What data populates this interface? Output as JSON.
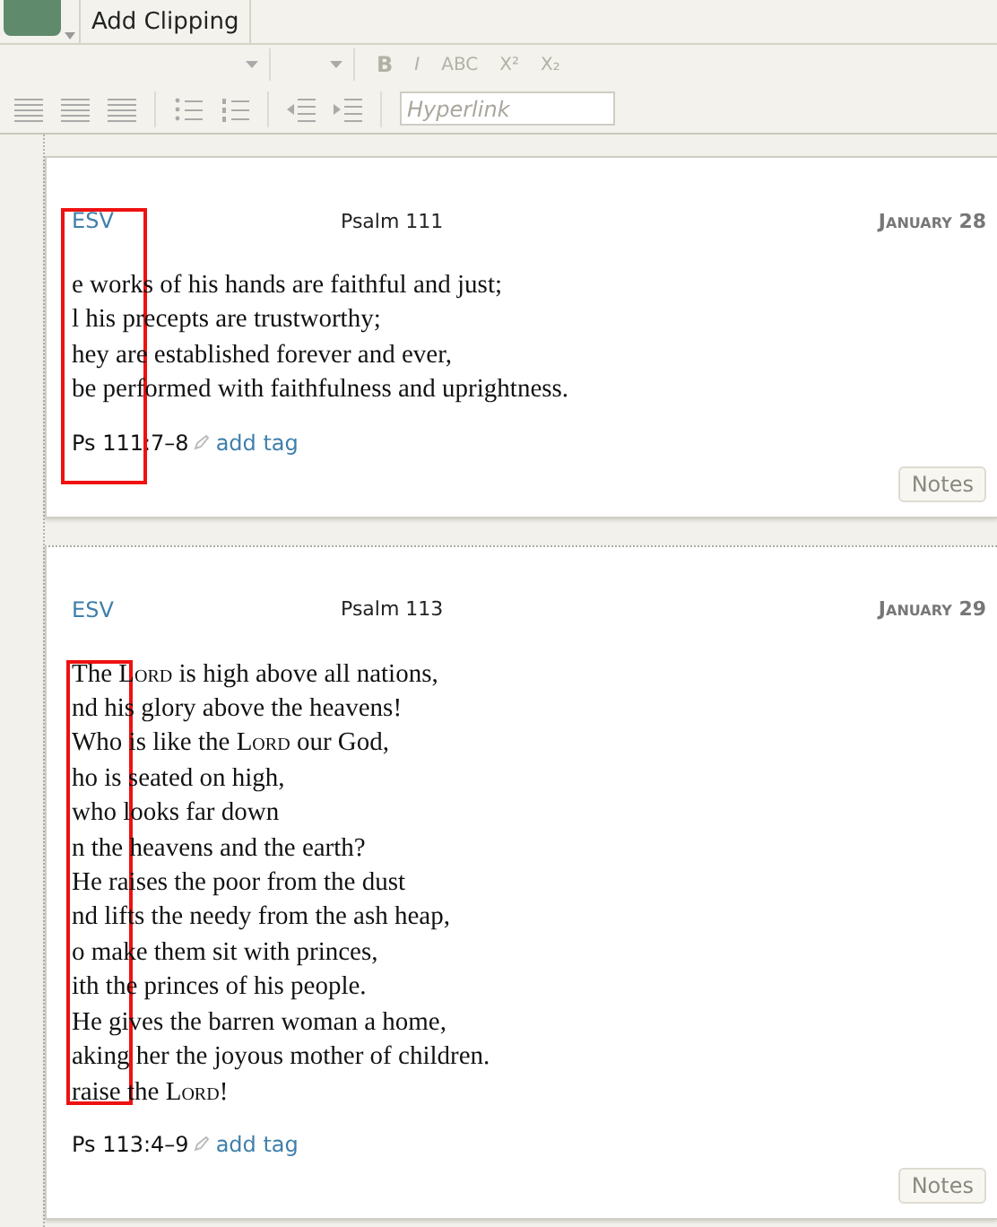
{
  "toolbar": {
    "add_clipping": "Add Clipping",
    "format_buttons": [
      "B",
      "I",
      "ABC",
      "X²",
      "X₂"
    ],
    "hyperlink": {
      "placeholder": "Hyperlink"
    }
  },
  "clippings": [
    {
      "version": "ESV",
      "title": "Psalm 111",
      "date": "January 28",
      "highlighted": true,
      "lines": [
        [
          {
            "text": "e works of his hands are faithful and just;",
            "small_caps": false
          }
        ],
        [
          {
            "text": "l his precepts are trustworthy;",
            "small_caps": false
          }
        ],
        [
          {
            "text": "hey are established forever and ever,",
            "small_caps": false
          }
        ],
        [
          {
            "text": "be performed with faithfulness and uprightness.",
            "small_caps": false
          }
        ]
      ],
      "reference": "Ps 111:7–8",
      "add_tag": "add tag",
      "notes": "Notes"
    },
    {
      "version": "ESV",
      "title": "Psalm 113",
      "date": "January 29",
      "highlighted": true,
      "lines": [
        [
          {
            "text": "The ",
            "small_caps": false
          },
          {
            "text": "Lord",
            "small_caps": true
          },
          {
            "text": " is high above all nations,",
            "small_caps": false
          }
        ],
        [
          {
            "text": "nd his glory above the heavens!",
            "small_caps": false
          }
        ],
        [
          {
            "text": "Who is like the ",
            "small_caps": false
          },
          {
            "text": "Lord",
            "small_caps": true
          },
          {
            "text": " our God,",
            "small_caps": false
          }
        ],
        [
          {
            "text": "ho is seated on high,",
            "small_caps": false
          }
        ],
        [
          {
            "text": "who looks far down",
            "small_caps": false
          }
        ],
        [
          {
            "text": "n the heavens and the earth?",
            "small_caps": false
          }
        ],
        [
          {
            "text": "He raises the poor from the dust",
            "small_caps": false
          }
        ],
        [
          {
            "text": "nd lifts the needy from the ash heap,",
            "small_caps": false
          }
        ],
        [
          {
            "text": "o make them sit with princes,",
            "small_caps": false
          }
        ],
        [
          {
            "text": "ith the princes of his people.",
            "small_caps": false
          }
        ],
        [
          {
            "text": "He gives the barren woman a home,",
            "small_caps": false
          }
        ],
        [
          {
            "text": "aking her the joyous mother of children.",
            "small_caps": false
          }
        ],
        [
          {
            "text": "raise the ",
            "small_caps": false
          },
          {
            "text": "Lord",
            "small_caps": true
          },
          {
            "text": "!",
            "small_caps": false
          }
        ]
      ],
      "reference": "Ps 113:4–9",
      "add_tag": "add tag",
      "notes": "Notes"
    }
  ]
}
